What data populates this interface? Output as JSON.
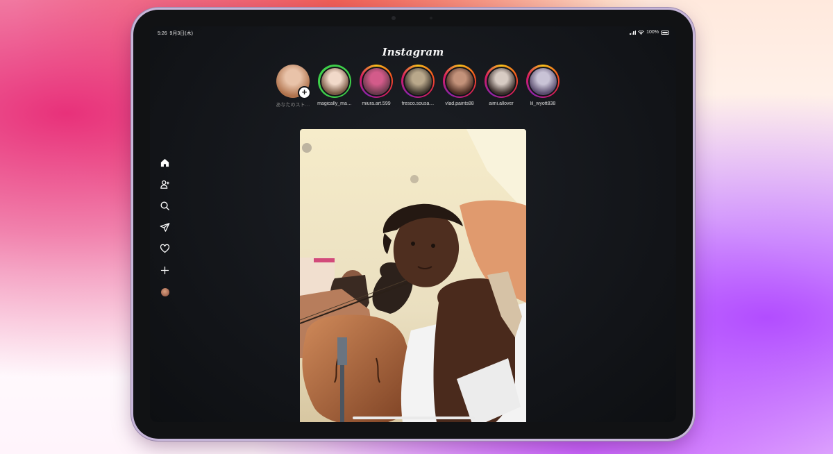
{
  "status_bar": {
    "time": "5:26",
    "date": "9月3日(木)",
    "battery": "100%"
  },
  "app": {
    "title": "Instagram"
  },
  "stories": [
    {
      "username": "あなたのスト…",
      "own": true,
      "ring": "none",
      "avatar_colors": [
        "#e9c3a9",
        "#b0734d"
      ]
    },
    {
      "username": "magically_ma…",
      "ring": "green",
      "avatar_colors": [
        "#f1d9c9",
        "#7a5a46"
      ]
    },
    {
      "username": "miura.art.599",
      "ring": "gradient",
      "avatar_colors": [
        "#d35b8a",
        "#6d3a4e"
      ]
    },
    {
      "username": "fresco.sousa…",
      "ring": "gradient",
      "avatar_colors": [
        "#b9a88b",
        "#3b332a"
      ]
    },
    {
      "username": "vlad.paints88",
      "ring": "gradient",
      "avatar_colors": [
        "#c3927a",
        "#4a2c22"
      ]
    },
    {
      "username": "aimi.allover",
      "ring": "gradient",
      "avatar_colors": [
        "#d7cbc3",
        "#3c2f2c"
      ]
    },
    {
      "username": "lil_wyott838",
      "ring": "gradient",
      "avatar_colors": [
        "#c9c3d6",
        "#5a4d6e"
      ]
    }
  ],
  "sidebar": {
    "items": [
      {
        "icon": "home-icon"
      },
      {
        "icon": "add-friend-icon"
      },
      {
        "icon": "search-icon"
      },
      {
        "icon": "direct-message-icon"
      },
      {
        "icon": "heart-icon"
      },
      {
        "icon": "create-plus-icon"
      },
      {
        "icon": "profile-avatar"
      }
    ]
  },
  "colors": {
    "accent_green": "#3ecf4a",
    "ring_gradient": [
      "#f9c21a",
      "#f4511e",
      "#d81b60",
      "#8e24aa"
    ]
  }
}
